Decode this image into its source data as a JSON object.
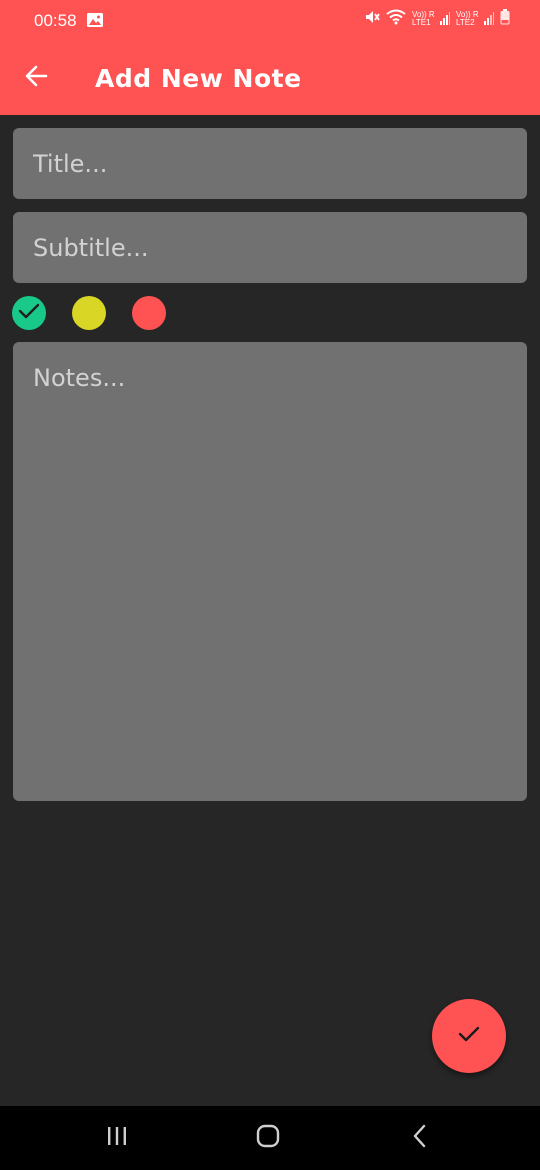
{
  "status_bar": {
    "time": "00:58",
    "sim1_label": "Vo)) R\nLTE1",
    "sim2_label": "Vo)) R\nLTE2"
  },
  "app_bar": {
    "title": "Add New Note",
    "back_icon": "arrow-left-icon"
  },
  "form": {
    "title_placeholder": "Title...",
    "subtitle_placeholder": "Subtitle...",
    "notes_placeholder": "Notes...",
    "title_value": "",
    "subtitle_value": "",
    "notes_value": ""
  },
  "colors": {
    "options": [
      {
        "name": "green",
        "hex": "#19c98a",
        "selected": true
      },
      {
        "name": "yellow",
        "hex": "#d9d626",
        "selected": false
      },
      {
        "name": "red",
        "hex": "#ff5252",
        "selected": false
      }
    ],
    "accent": "#ff5252",
    "background": "#262626",
    "field_background": "#717171"
  },
  "fab": {
    "icon": "check-icon"
  },
  "nav_bar": {
    "recents_icon": "recents-icon",
    "home_icon": "home-icon",
    "back_icon": "nav-back-icon"
  }
}
